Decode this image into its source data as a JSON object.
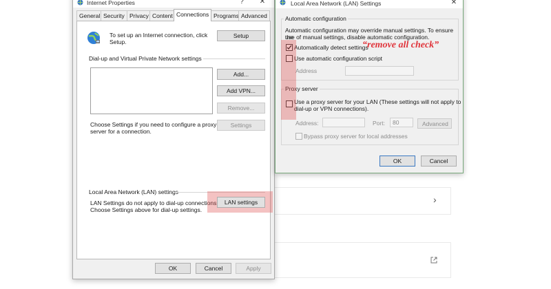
{
  "internet_properties": {
    "title": "Internet Properties",
    "tabs": [
      "General",
      "Security",
      "Privacy",
      "Content",
      "Connections",
      "Programs",
      "Advanced"
    ],
    "active_tab": "Connections",
    "setup_text_1": "To set up an Internet connection, click",
    "setup_text_2": "Setup.",
    "setup_button": "Setup",
    "dialup_heading": "Dial-up and Virtual Private Network settings",
    "add_button": "Add...",
    "add_vpn_button": "Add VPN...",
    "remove_button": "Remove...",
    "settings_text_1": "Choose Settings if you need to configure a proxy",
    "settings_text_2": "server for a connection.",
    "settings_button": "Settings",
    "lan_heading": "Local Area Network (LAN) settings",
    "lan_text_1": "LAN Settings do not apply to dial-up connections.",
    "lan_text_2": "Choose Settings above for dial-up settings.",
    "lan_settings_button": "LAN settings",
    "ok_button": "OK",
    "cancel_button": "Cancel",
    "apply_button": "Apply"
  },
  "lan_dialog": {
    "title": "Local Area Network (LAN) Settings",
    "auto_config_heading": "Automatic configuration",
    "auto_config_desc_1": "Automatic configuration may override manual settings.  To ensure the",
    "auto_config_desc_2": "use of manual settings, disable automatic configuration.",
    "auto_detect_label": "Automatically detect settings",
    "auto_detect_checked": true,
    "use_script_label": "Use automatic configuration script",
    "use_script_checked": false,
    "address_label": "Address",
    "proxy_heading": "Proxy server",
    "proxy_label_1": "Use a proxy server for your LAN (These settings will not apply to",
    "proxy_label_2": "dial-up or VPN connections).",
    "proxy_checked": false,
    "proxy_address_label": "Address:",
    "port_label": "Port:",
    "port_value": "80",
    "advanced_button": "Advanced",
    "bypass_label": "Bypass proxy server for local addresses",
    "bypass_checked": false,
    "ok_button": "OK",
    "cancel_button": "Cancel"
  },
  "annotation": {
    "text": "“remove all check”",
    "color": "#e0343b"
  },
  "icons": {
    "window_icon": "internet-options-icon",
    "globe": "globe-network-icon",
    "help": "?",
    "close": "✕",
    "chevron": "›",
    "external": "external-link-icon"
  }
}
